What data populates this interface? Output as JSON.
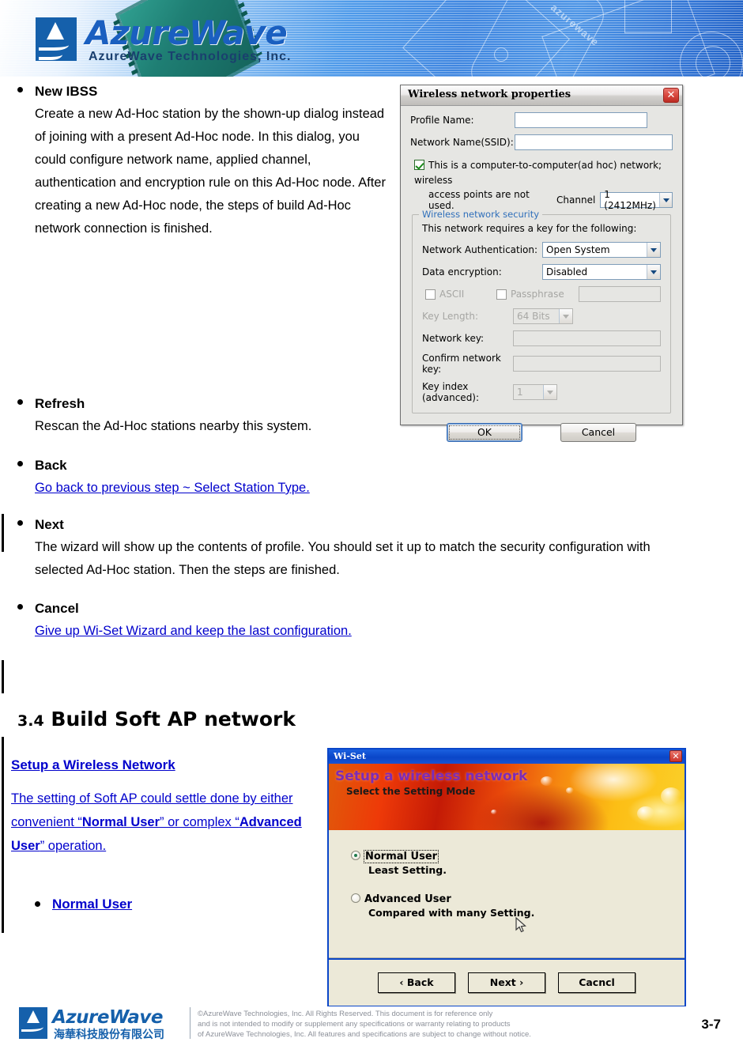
{
  "header": {
    "brand": "AzureWave",
    "subtitle": "AzureWave  Technologies,  Inc.",
    "watermark": "azurewave"
  },
  "content": {
    "sections": [
      {
        "title": "New IBSS",
        "body": "Create a new Ad-Hoc station by the shown-up dialog instead of joining with a present Ad-Hoc node. In this dialog, you could configure network name, applied channel, authentication and encryption rule on this Ad-Hoc node. After creating a new Ad-Hoc node, the steps of build Ad-Hoc network connection is finished.",
        "body_is_link": false
      },
      {
        "title": "Refresh",
        "body": "Rescan the Ad-Hoc stations nearby this system.",
        "body_is_link": false
      },
      {
        "title": "Back",
        "body": "Go back to previous step ~ Select Station Type.",
        "body_is_link": true
      },
      {
        "title": "Next",
        "body": "The wizard will show up the contents of profile. You should set it up to match the security configuration with selected Ad-Hoc station. Then the steps are finished.",
        "body_is_link": false
      },
      {
        "title": "Cancel",
        "body": "Give up Wi-Set Wizard and keep the last configuration.",
        "body_is_link": true
      }
    ]
  },
  "section_heading": {
    "number": "3.4",
    "title": "Build Soft AP network"
  },
  "soft_ap": {
    "link_heading": "Setup a Wireless Network",
    "intro_part1": "The setting of Soft AP could settle done by either convenient “",
    "intro_bold1": "Normal User",
    "intro_part2": "” or complex “",
    "intro_bold2": "Advanced User",
    "intro_part3": "” operation.",
    "bullet_normal_user": "Normal User"
  },
  "wireless_network_properties": {
    "title": "Wireless network properties",
    "close_label": "✕",
    "profile_name_label": "Profile Name:",
    "profile_name_value": "",
    "ssid_label": "Network Name(SSID):",
    "ssid_value": "",
    "adhoc_checkbox_line1": "This is a computer-to-computer(ad hoc) network; wireless",
    "adhoc_checkbox_line2": "access points are not used.",
    "adhoc_checked": true,
    "channel_label": "Channel",
    "channel_value": "1  (2412MHz)",
    "security_group_title": "Wireless network security",
    "security_intro": "This network requires a key for the following:",
    "auth_label": "Network Authentication:",
    "auth_value": "Open System",
    "encryption_label": "Data encryption:",
    "encryption_value": "Disabled",
    "ascii_label": "ASCII",
    "passphrase_label": "Passphrase",
    "passphrase_value": "",
    "key_length_label": "Key Length:",
    "key_length_value": "64 Bits",
    "network_key_label": "Network key:",
    "network_key_value": "",
    "confirm_key_label": "Confirm network key:",
    "confirm_key_value": "",
    "key_index_label": "Key index (advanced):",
    "key_index_value": "1",
    "ok_label": "OK",
    "cancel_label": "Cancel"
  },
  "wiset_dialog": {
    "title": "Wi-Set",
    "close_label": "✕",
    "banner_title": "Setup a wireless network",
    "banner_subtitle": "Select the Setting Mode",
    "options": [
      {
        "label": "Normal User",
        "description": "Least Setting.",
        "selected": true
      },
      {
        "label": "Advanced User",
        "description": "Compared with many Setting.",
        "selected": false
      }
    ],
    "back_label": "‹ Back",
    "next_label": "Next ›",
    "cancel_label": "Cacncl"
  },
  "footer": {
    "brand": "AzureWave",
    "brand_cn": "海華科技股份有限公司",
    "legal_line1": "©AzureWave Technologies, Inc. All Rights Reserved. This document is for reference only",
    "legal_line2": "and is not intended to modify or supplement any specifications or  warranty relating to products",
    "legal_line3": "of AzureWave Technologies, Inc.  All features and specifications are subject to change without notice.",
    "page_number": "3-7"
  },
  "colors": {
    "link": "#0000cc",
    "brand_blue": "#1560ab",
    "dialog_accent": "#0a46c8"
  }
}
